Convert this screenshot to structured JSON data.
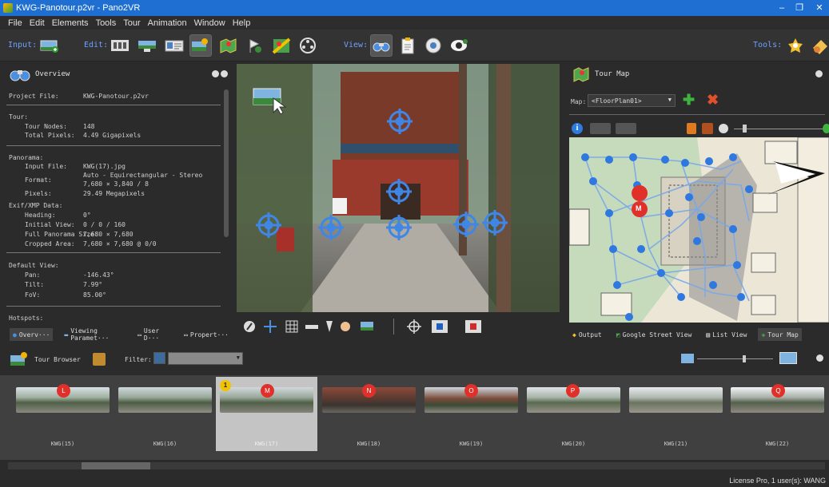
{
  "window": {
    "title": "KWG-Panotour.p2vr - Pano2VR",
    "minimize": "–",
    "maximize": "❐",
    "close": "✕"
  },
  "menu": [
    "File",
    "Edit",
    "Elements",
    "Tools",
    "Tour",
    "Animation",
    "Window",
    "Help"
  ],
  "toolbar": {
    "input_label": "Input:",
    "edit_label": "Edit:",
    "view_label": "View:",
    "tools_label": "Tools:"
  },
  "overview": {
    "title": "Overview",
    "project_file_label": "Project File:",
    "project_file": "KWG-Panotour.p2vr",
    "tour_header": "Tour:",
    "tour_nodes_label": "Tour Nodes:",
    "tour_nodes": "148",
    "total_pixels_label": "Total Pixels:",
    "total_pixels": "4.49 Gigapixels",
    "panorama_header": "Panorama:",
    "input_file_label": "Input File:",
    "input_file": "KWG(17).jpg",
    "format_label": "Format:",
    "format_line1": "Auto - Equirectangular - Stereo",
    "format_line2": "7,680 × 3,840 / 8",
    "pixels_label": "Pixels:",
    "pixels": "29.49 Megapixels",
    "exif_header": "Exif/XMP Data:",
    "heading_label": "Heading:",
    "heading": "0°",
    "initial_view_label": "Initial View:",
    "initial_view": "0 / 0 / 160",
    "full_pano_label": "Full Panorama Size:",
    "full_pano": "7,680 × 7,680",
    "cropped_label": "Cropped Area:",
    "cropped": "7,680 × 7,680 @ 0/0",
    "default_view_header": "Default View:",
    "pan_label": "Pan:",
    "pan": "-146.43°",
    "tilt_label": "Tilt:",
    "tilt": "7.99°",
    "fov_label": "FoV:",
    "fov": "85.00°",
    "hotspots_header": "Hotspots:"
  },
  "left_tabs": [
    "Overv···",
    "Viewing Paramet···",
    "User D···",
    "Propert···"
  ],
  "tour_map": {
    "title": "Tour Map",
    "map_label": "Map:",
    "map_select": "<FloorPlan01>",
    "current_pin": "M"
  },
  "right_tabs": [
    "Output",
    "Google Street View",
    "List View",
    "Tour Map"
  ],
  "tour_browser": {
    "title": "Tour Browser",
    "filter_label": "Filter:"
  },
  "thumbnails": [
    {
      "label": "KWG(15)",
      "pin": "L"
    },
    {
      "label": "KWG(16)",
      "pin": ""
    },
    {
      "label": "KWG(17)",
      "pin": "M"
    },
    {
      "label": "KWG(18)",
      "pin": "N"
    },
    {
      "label": "KWG(19)",
      "pin": "O"
    },
    {
      "label": "KWG(20)",
      "pin": "P"
    },
    {
      "label": "KWG(21)",
      "pin": ""
    },
    {
      "label": "KWG(22)",
      "pin": "Q"
    }
  ],
  "selected_badge": "1",
  "status": {
    "license": "License Pro, 1 user(s): WANG"
  }
}
